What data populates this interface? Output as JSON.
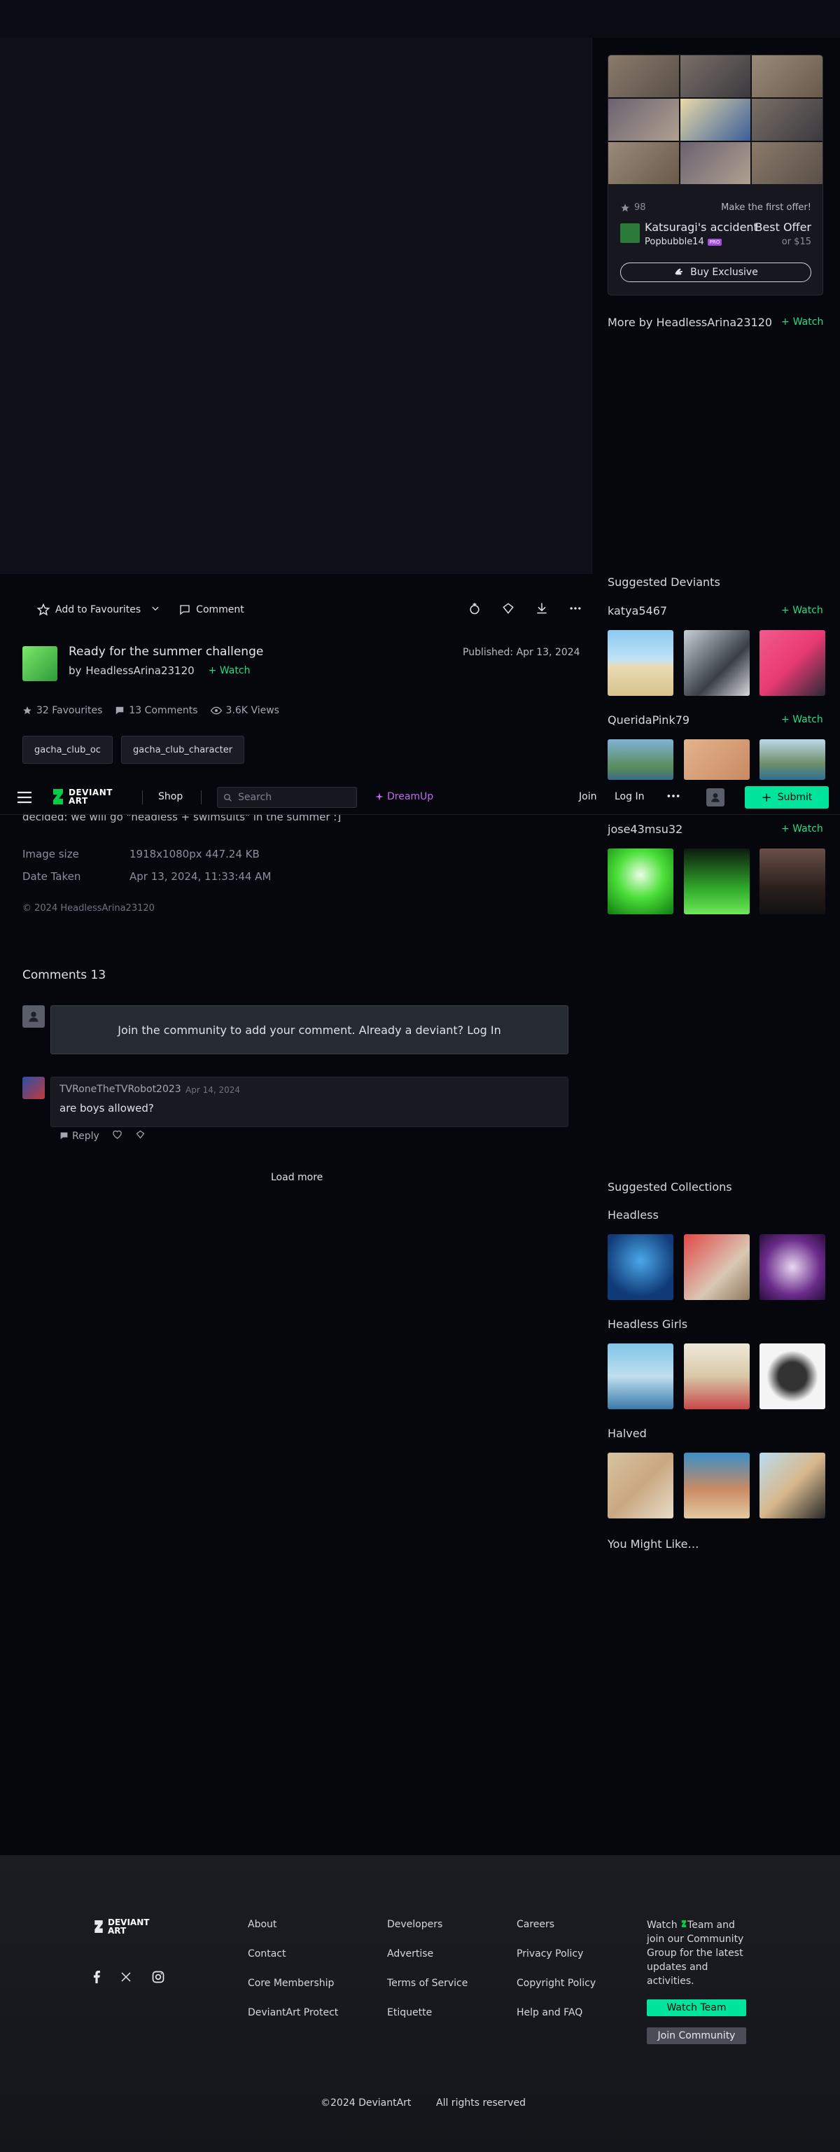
{
  "offer": {
    "favourites": "98",
    "first_offer": "Make the first offer!",
    "title": "Katsuragi's accident",
    "best_offer": "Best Offer",
    "author": "Popbubble14",
    "badge": "PRO",
    "price": "or $15",
    "buy_label": "Buy Exclusive"
  },
  "more_by": {
    "label": "More by HeadlessArina23120",
    "watch": "Watch"
  },
  "actions": {
    "favourite": "Add to Favourites",
    "comment": "Comment"
  },
  "deviation": {
    "title": "Ready for the summer challenge",
    "by": "by",
    "author": "HeadlessArina23120",
    "watch": "Watch",
    "published": "Published: Apr 13, 2024",
    "favourites": "32 Favourites",
    "comments": "13 Comments",
    "views": "3.6K Views",
    "tags": [
      "gacha_club_oc",
      "gacha_club_character"
    ],
    "description": "decided: we will go \"headless + swimsuits\" in the summer :]"
  },
  "details": {
    "size_label": "Image size",
    "size_value": "1918x1080px 447.24 KB",
    "date_label": "Date Taken",
    "date_value": "Apr 13, 2024, 11:33:44 AM",
    "copyright": "© 2024 HeadlessArina23120"
  },
  "nav": {
    "logo_line1": "DEVIANT",
    "logo_line2": "ART",
    "shop": "Shop",
    "search_placeholder": "Search",
    "dreamup": "DreamUp",
    "join": "Join",
    "login": "Log In",
    "submit": "Submit"
  },
  "comments": {
    "heading": "Comments 13",
    "join_prompt": "Join the community to add your comment. Already a deviant? Log In",
    "items": [
      {
        "author": "TVRoneTheTVRobot2023",
        "date": "Apr 14, 2024",
        "text": "are boys allowed?",
        "reply": "Reply"
      }
    ],
    "load_more": "Load more"
  },
  "suggested_deviants": {
    "title": "Suggested Deviants",
    "watch": "Watch",
    "users": [
      {
        "name": "katya5467"
      },
      {
        "name": "QueridaPink79"
      },
      {
        "name": "jose43msu32"
      }
    ]
  },
  "suggested_collections": {
    "title": "Suggested Collections",
    "items": [
      {
        "name": "Headless"
      },
      {
        "name": "Headless Girls"
      },
      {
        "name": "Halved"
      }
    ]
  },
  "you_might_like": "You Might Like…",
  "footer": {
    "logo_line1": "DEVIANT",
    "logo_line2": "ART",
    "col1": [
      "About",
      "Contact",
      "Core Membership",
      "DeviantArt Protect"
    ],
    "col2": [
      "Developers",
      "Advertise",
      "Terms of Service",
      "Etiquette"
    ],
    "col3": [
      "Careers",
      "Privacy Policy",
      "Copyright Policy",
      "Help and FAQ"
    ],
    "watch_team_text_1": "Watch",
    "watch_team_text_2": "Team and join our Community Group for the latest updates and activities.",
    "watch_team_btn": "Watch Team",
    "join_community_btn": "Join Community",
    "copyright": "©2024 DeviantArt",
    "rights": "All rights reserved"
  },
  "colors": {
    "accent": "#00e59b",
    "watch_green": "#22dd88",
    "dreamup": "#c36bf0",
    "background": "#06070d"
  }
}
